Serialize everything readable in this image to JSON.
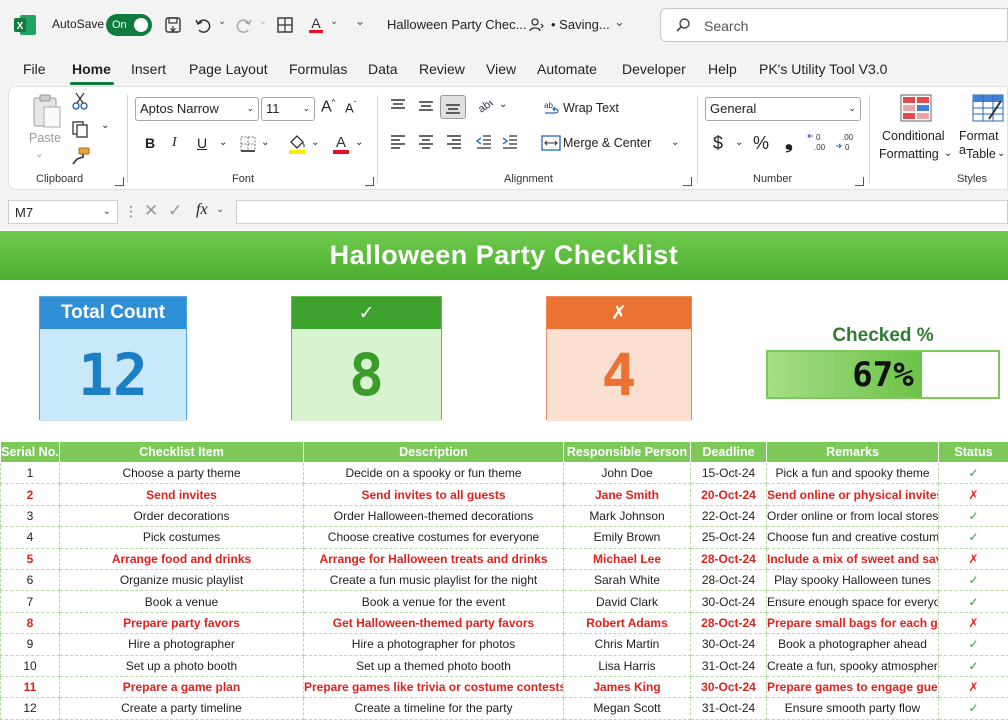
{
  "titlebar": {
    "autosave_label": "AutoSave",
    "autosave_state": "On",
    "document_title": "Halloween Party Chec...",
    "saving_status": "• Saving...",
    "search_placeholder": "Search"
  },
  "menu_tabs": [
    "File",
    "Home",
    "Insert",
    "Page Layout",
    "Formulas",
    "Data",
    "Review",
    "View",
    "Automate",
    "Developer",
    "Help",
    "PK's Utility Tool V3.0"
  ],
  "active_tab": "Home",
  "ribbon": {
    "clipboard": {
      "label": "Clipboard",
      "paste": "Paste"
    },
    "font": {
      "label": "Font",
      "font_name": "Aptos Narrow",
      "font_size": "11",
      "bold": "B",
      "italic": "I",
      "underline": "U"
    },
    "alignment": {
      "label": "Alignment",
      "wrap_text": "Wrap Text",
      "merge_center": "Merge & Center"
    },
    "number": {
      "label": "Number",
      "format": "General",
      "currency": "$",
      "percent": "%",
      "comma": "❟"
    },
    "styles": {
      "label": "Styles",
      "conditional_line1": "Conditional",
      "conditional_line2": "Formatting",
      "format_table_line1": "Format a",
      "format_table_line2": "Table"
    }
  },
  "formula_bar": {
    "name_box": "M7",
    "fx": "fx",
    "value": ""
  },
  "sheet": {
    "banner_title": "Halloween Party Checklist",
    "cards": [
      {
        "header": "Total Count",
        "value": "12",
        "header_color": "#2e8fd6",
        "body_color": "#c9e8fa",
        "value_color": "#1c7fc4",
        "border_color": "#52a8dd"
      },
      {
        "header": "✓",
        "value": "8",
        "header_color": "#3ea22e",
        "body_color": "#d7f3cf",
        "value_color": "#3b9c2c",
        "border_color": "#66bb50"
      },
      {
        "header": "✗",
        "value": "4",
        "header_color": "#ec7233",
        "body_color": "#fbe0d2",
        "value_color": "#ec7233",
        "border_color": "#ee8a55"
      }
    ],
    "checked": {
      "label": "Checked %",
      "display": "67%",
      "fraction": 0.67
    },
    "table": {
      "headers": [
        "Serial No.",
        "Checklist Item",
        "Description",
        "Responsible Person",
        "Deadline",
        "Remarks",
        "Status"
      ],
      "rows": [
        {
          "cells": [
            "1",
            "Choose a party theme",
            "Decide on a spooky or fun theme",
            "John Doe",
            "15-Oct-24",
            "Pick a fun and spooky theme",
            "✓"
          ],
          "done": true
        },
        {
          "cells": [
            "2",
            "Send invites",
            "Send invites to all guests",
            "Jane Smith",
            "20-Oct-24",
            "Send online or physical invites",
            "✗"
          ],
          "done": false
        },
        {
          "cells": [
            "3",
            "Order decorations",
            "Order Halloween-themed decorations",
            "Mark Johnson",
            "22-Oct-24",
            "Order online or from local stores",
            "✓"
          ],
          "done": true
        },
        {
          "cells": [
            "4",
            "Pick costumes",
            "Choose creative costumes for everyone",
            "Emily Brown",
            "25-Oct-24",
            "Choose fun and creative costume",
            "✓"
          ],
          "done": true
        },
        {
          "cells": [
            "5",
            "Arrange food and drinks",
            "Arrange for Halloween treats and drinks",
            "Michael Lee",
            "28-Oct-24",
            "Include a mix of sweet and savory",
            "✗"
          ],
          "done": false
        },
        {
          "cells": [
            "6",
            "Organize music playlist",
            "Create a fun music playlist for the night",
            "Sarah White",
            "28-Oct-24",
            "Play spooky Halloween tunes",
            "✓"
          ],
          "done": true
        },
        {
          "cells": [
            "7",
            "Book a venue",
            "Book a venue for the event",
            "David Clark",
            "30-Oct-24",
            "Ensure enough space for everyone",
            "✓"
          ],
          "done": true
        },
        {
          "cells": [
            "8",
            "Prepare party favors",
            "Get Halloween-themed party favors",
            "Robert Adams",
            "28-Oct-24",
            "Prepare small bags for each guest",
            "✗"
          ],
          "done": false
        },
        {
          "cells": [
            "9",
            "Hire a photographer",
            "Hire a photographer for photos",
            "Chris Martin",
            "30-Oct-24",
            "Book a photographer ahead",
            "✓"
          ],
          "done": true
        },
        {
          "cells": [
            "10",
            "Set up a photo booth",
            "Set up a themed photo booth",
            "Lisa Harris",
            "31-Oct-24",
            "Create a fun, spooky atmosphere",
            "✓"
          ],
          "done": true
        },
        {
          "cells": [
            "11",
            "Prepare a game plan",
            "Prepare games like trivia or costume contests",
            "James King",
            "30-Oct-24",
            "Prepare games to engage guests",
            "✗"
          ],
          "done": false
        },
        {
          "cells": [
            "12",
            "Create a party timeline",
            "Create a timeline for the party",
            "Megan Scott",
            "31-Oct-24",
            "Ensure smooth party flow",
            "✓"
          ],
          "done": true
        }
      ]
    }
  }
}
